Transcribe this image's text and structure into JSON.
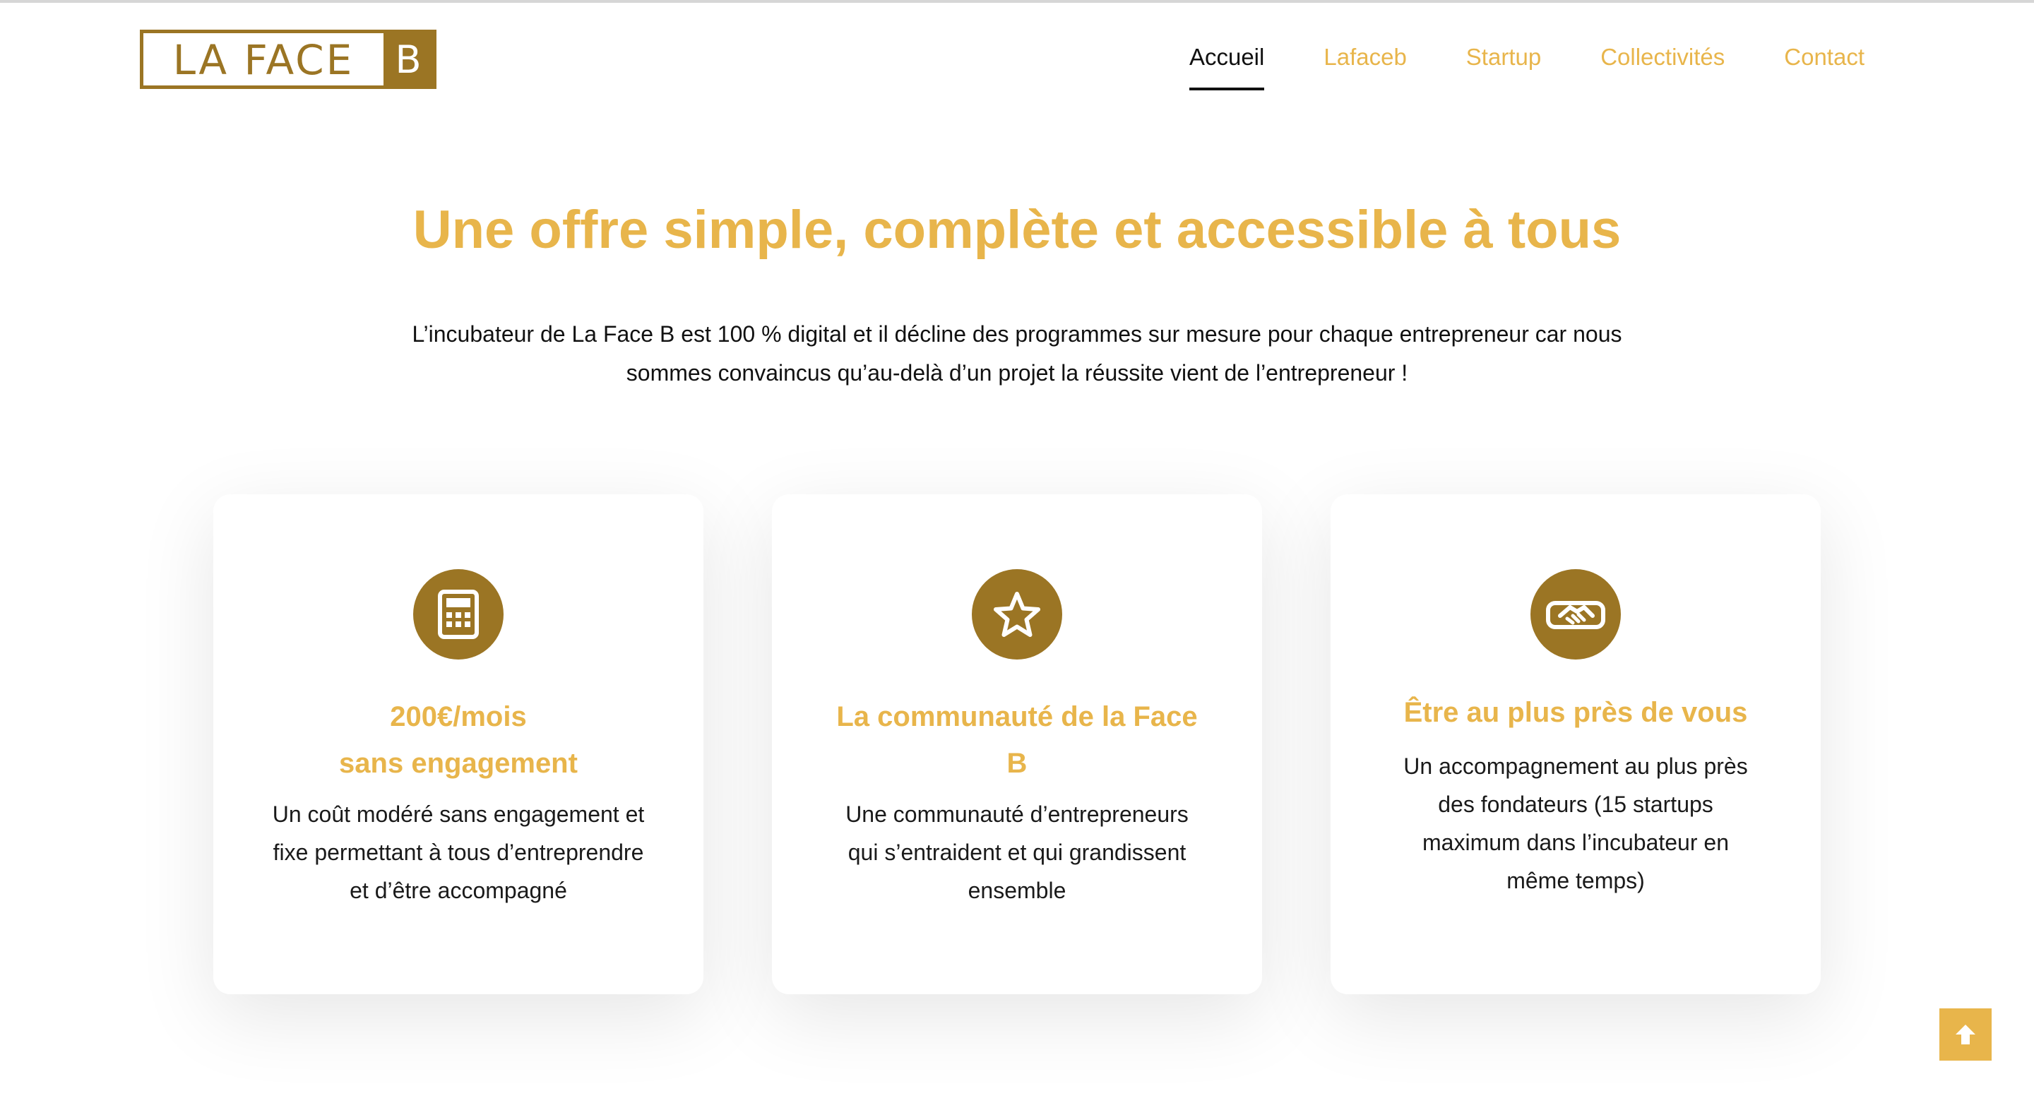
{
  "logo": {
    "text": "LA FACE",
    "letter": "B"
  },
  "nav": {
    "items": [
      {
        "label": "Accueil",
        "active": true
      },
      {
        "label": "Lafaceb",
        "active": false
      },
      {
        "label": "Startup",
        "active": false
      },
      {
        "label": "Collectivités",
        "active": false
      },
      {
        "label": "Contact",
        "active": false
      }
    ]
  },
  "hero": {
    "title": "Une offre simple, complète et accessible à tous",
    "intro_line1": "L’incubateur de La Face B est 100 % digital et il décline des programmes sur mesure pour chaque entrepreneur car nous",
    "intro_line2": "sommes convaincus qu’au-delà d’un projet la réussite vient de l’entrepreneur !"
  },
  "cards": [
    {
      "icon": "calculator-icon",
      "title_line1": "200€/mois",
      "title_line2": "sans engagement",
      "text_line1": "Un coût modéré sans engagement et",
      "text_line2": "fixe permettant à tous d’entreprendre",
      "text_line3": "et d’être accompagné",
      "text_line4": ""
    },
    {
      "icon": "star-icon",
      "title_line1": "La communauté de la Face",
      "title_line2": "B",
      "text_line1": "Une communauté d’entrepreneurs",
      "text_line2": "qui s’entraident et qui grandissent",
      "text_line3": "ensemble",
      "text_line4": ""
    },
    {
      "icon": "handshake-icon",
      "title_line1": "Être au plus près de vous",
      "title_line2": "",
      "text_line1": "Un accompagnement au plus près",
      "text_line2": "des fondateurs (15 startups",
      "text_line3": "maximum dans l’incubateur en",
      "text_line4": "même temps)"
    }
  ],
  "colors": {
    "accent": "#e8b54b",
    "brand": "#9b7524",
    "text": "#111111"
  },
  "scroll_top": {
    "icon": "arrow-up-icon"
  }
}
